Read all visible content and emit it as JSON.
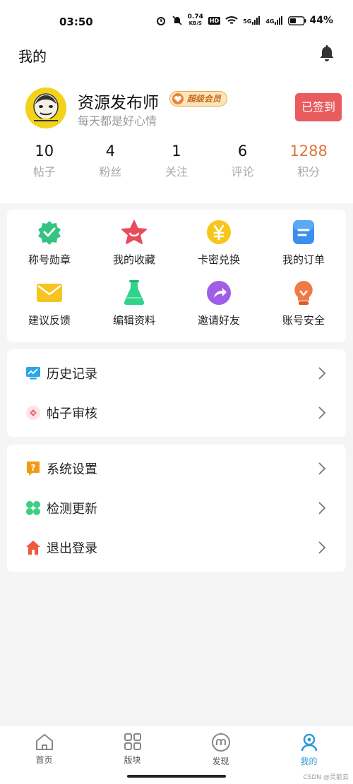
{
  "status_bar": {
    "time": "03:50",
    "net_speed_top": "0.74",
    "net_speed_bottom": "KB/S",
    "hd": "HD",
    "sig1": "5G",
    "sig2": "4G",
    "battery": "44%"
  },
  "header": {
    "title": "我的"
  },
  "profile": {
    "name": "资源发布师",
    "vip": "超级会员",
    "motto": "每天都是好心情",
    "checkin": "已签到",
    "stats": [
      {
        "num": "10",
        "label": "帖子"
      },
      {
        "num": "4",
        "label": "粉丝"
      },
      {
        "num": "1",
        "label": "关注"
      },
      {
        "num": "6",
        "label": "评论"
      },
      {
        "num": "1288",
        "label": "积分"
      }
    ]
  },
  "grid": [
    {
      "label": "称号勋章",
      "icon": "badge-icon",
      "color": "#33c481"
    },
    {
      "label": "我的收藏",
      "icon": "star-icon",
      "color": "#ea4b5a"
    },
    {
      "label": "卡密兑换",
      "icon": "yen-icon",
      "color": "#f6c719"
    },
    {
      "label": "我的订单",
      "icon": "order-icon",
      "color": "#3b8ff0"
    },
    {
      "label": "建议反馈",
      "icon": "mail-icon",
      "color": "#f6c521"
    },
    {
      "label": "编辑资料",
      "icon": "flask-icon",
      "color": "#2fd38a"
    },
    {
      "label": "邀请好友",
      "icon": "share-icon",
      "color": "#a05de6"
    },
    {
      "label": "账号安全",
      "icon": "bulb-icon",
      "color": "#f07a45"
    }
  ],
  "list1": [
    {
      "label": "历史记录",
      "icon": "history-icon"
    },
    {
      "label": "帖子审核",
      "icon": "review-icon"
    }
  ],
  "list2": [
    {
      "label": "系统设置",
      "icon": "settings-icon"
    },
    {
      "label": "检测更新",
      "icon": "update-icon"
    },
    {
      "label": "退出登录",
      "icon": "logout-icon"
    }
  ],
  "tabs": [
    {
      "label": "首页"
    },
    {
      "label": "版块"
    },
    {
      "label": "发现"
    },
    {
      "label": "我的"
    }
  ],
  "watermark": "CSDN @灵能云",
  "colors": {
    "accent": "#2f9ad8",
    "checkin": "#ea5b5e",
    "points": "#e0763a"
  }
}
